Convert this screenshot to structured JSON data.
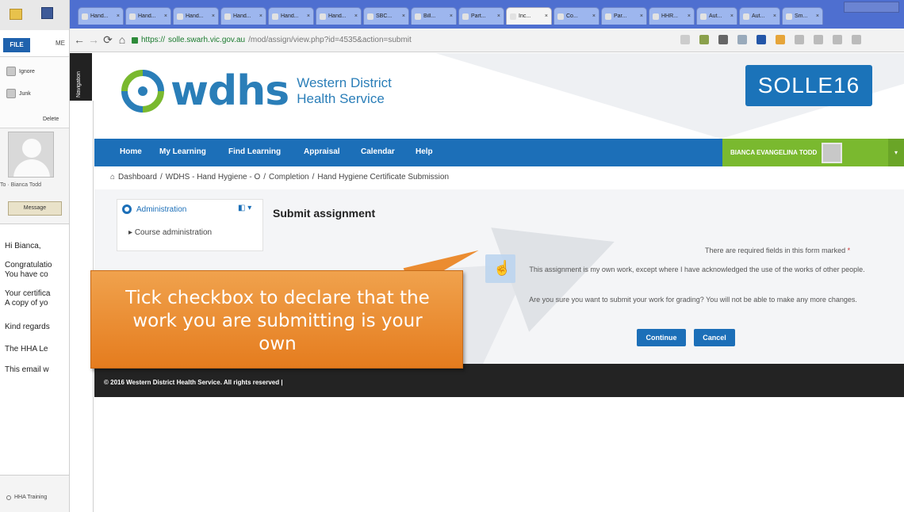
{
  "outlook": {
    "file_tab": "FILE",
    "message_tab": "ME",
    "ignore_label": "Ignore",
    "junk_label": "Junk",
    "delete_label": "Delete",
    "to_label": "To · Bianca Todd",
    "message_button": "Message",
    "body_lines": [
      "Hi Bianca,",
      "Congratulatio",
      "You have co",
      "Your certifica",
      "A copy of yo",
      "Kind regards",
      "The HHA Le",
      "This email w"
    ],
    "bottom_label": "HHA Training"
  },
  "browser": {
    "tabs": [
      "Hand...",
      "Hand...",
      "Hand...",
      "Hand...",
      "Hand...",
      "Hand...",
      "SBC...",
      "Bill...",
      "Part...",
      "Inc...",
      "Co...",
      "Par...",
      "HHR...",
      "Aut...",
      "Aut...",
      "Sm..."
    ],
    "url_scheme": "https://",
    "url_host": "solle.swarh.vic.gov.au",
    "url_path": "/mod/assign/view.php?id=4535&action=submit",
    "colors": {
      "tabbar": "#4e6fd0"
    }
  },
  "header": {
    "logo_word": "wdhs",
    "logo_line1": "Western District",
    "logo_line2": "Health Service",
    "badge": "SOLLE16"
  },
  "nav": {
    "items": [
      "Home",
      "My Learning",
      "Find Learning",
      "Appraisal",
      "Calendar",
      "Help"
    ],
    "user_name": "BIANCA EVANGELINA TODD"
  },
  "breadcrumb": {
    "items": [
      "Dashboard",
      "WDHS - Hand Hygiene - O",
      "Completion",
      "Hand Hygiene Certificate Submission"
    ]
  },
  "admin_block": {
    "title": "Administration",
    "link": "Course administration"
  },
  "form": {
    "heading": "Submit assignment",
    "required_note": "There are required fields in this form marked",
    "required_mark": "*",
    "declaration": "This assignment is my own work, except where I have acknowledged the use of the works of other people.",
    "confirm": "Are you sure you want to submit your work for grading? You will not be able to make any more changes.",
    "continue_label": "Continue",
    "cancel_label": "Cancel"
  },
  "footer": {
    "copyright": "© 2016 Western District Health Service. All rights reserved |"
  },
  "callout": {
    "text": "Tick checkbox to declare that the work you are submitting is your own"
  }
}
